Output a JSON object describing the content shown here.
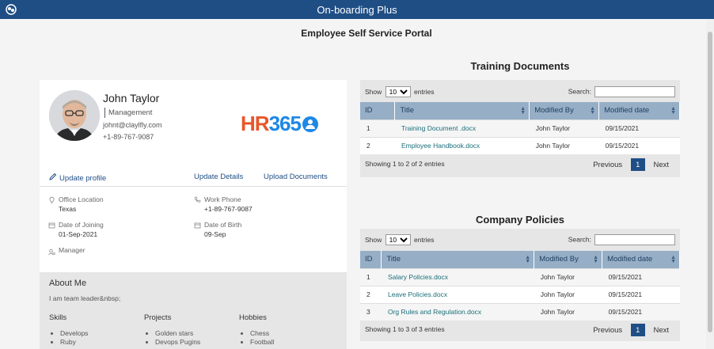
{
  "app": {
    "title": "On-boarding Plus"
  },
  "page": {
    "title": "Employee Self Service Portal"
  },
  "profile": {
    "name": "John Taylor",
    "department": "Management",
    "email": "johnt@claylfly.com",
    "phone": "+1-89-767-9087",
    "logo_hr": "HR",
    "logo_num": "365",
    "links": {
      "update_profile": "Update profile",
      "update_details": "Update Details",
      "upload_documents": "Upload Documents"
    },
    "details": {
      "office_location_label": "Office Location",
      "office_location": "Texas",
      "work_phone_label": "Work Phone",
      "work_phone": "+1-89-767-9087",
      "date_of_joining_label": "Date of Joining",
      "date_of_joining": "01-Sep-2021",
      "date_of_birth_label": "Date of Birth",
      "date_of_birth": "09-Sep",
      "manager_label": "Manager"
    },
    "about": {
      "heading": "About Me",
      "text": "I am team leader&nbsp;",
      "skills_heading": "Skills",
      "skills": [
        "Develops",
        "Ruby"
      ],
      "projects_heading": "Projects",
      "projects": [
        "Golden stars",
        "Devops Pugins"
      ],
      "hobbies_heading": "Hobbies",
      "hobbies": [
        "Chess",
        "Football"
      ]
    }
  },
  "training": {
    "title": "Training Documents",
    "show": "Show",
    "entries": "entries",
    "page_size": "10",
    "search_label": "Search:",
    "columns": [
      "ID",
      "Title",
      "Modified By",
      "Modified date"
    ],
    "rows": [
      [
        "1",
        "Training Document .docx",
        "John Taylor",
        "09/15/2021"
      ],
      [
        "2",
        "Employee Handbook.docx",
        "John Taylor",
        "09/15/2021"
      ]
    ],
    "info": "Showing 1 to 2 of 2 entries",
    "previous": "Previous",
    "page": "1",
    "next": "Next"
  },
  "policies": {
    "title": "Company Policies",
    "show": "Show",
    "entries": "entries",
    "page_size": "10",
    "search_label": "Search:",
    "columns": [
      "ID",
      "Title",
      "Modified By",
      "Modified date"
    ],
    "rows": [
      [
        "1",
        "Salary Policies.docx",
        "John Taylor",
        "09/15/2021"
      ],
      [
        "2",
        "Leave Policies.docx",
        "John Taylor",
        "09/15/2021"
      ],
      [
        "3",
        "Org Rules and Regulation.docx",
        "John Taylor",
        "09/15/2021"
      ]
    ],
    "info": "Showing 1 to 3 of 3 entries",
    "previous": "Previous",
    "page": "1",
    "next": "Next"
  },
  "colors": {
    "brand": "#1f4e85",
    "table_header": "#96aec6",
    "link": "#1a6f7a",
    "panel": "#e6e6e6"
  },
  "icons": [
    "app-logo-icon",
    "pencil-icon",
    "location-pin-icon",
    "phone-icon",
    "calendar-icon",
    "manager-icon",
    "sort-icon"
  ]
}
